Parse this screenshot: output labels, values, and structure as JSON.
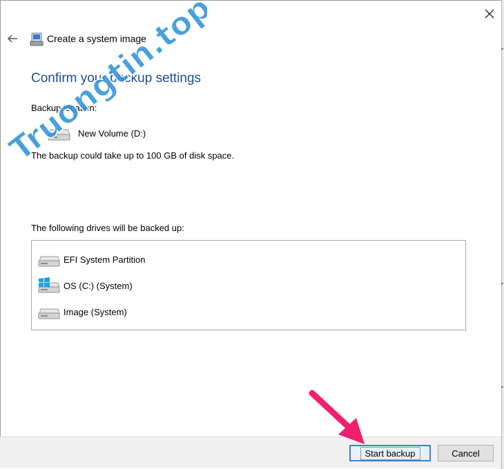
{
  "window": {
    "title": "Create a system image"
  },
  "page": {
    "heading": "Confirm your backup settings",
    "backup_location_label": "Backup location:",
    "backup_location_drive": "New Volume (D:)",
    "space_note": "The backup could take up to 100 GB of disk space.",
    "drives_label": "The following drives will be backed up:",
    "drives": [
      {
        "name": "EFI System Partition",
        "icon": "drive-icon"
      },
      {
        "name": "OS (C:) (System)",
        "icon": "windows-drive-icon"
      },
      {
        "name": "Image (System)",
        "icon": "drive-icon"
      }
    ]
  },
  "buttons": {
    "start_backup": "Start backup",
    "cancel": "Cancel"
  },
  "watermark_text": "Truongtin.top",
  "colors": {
    "heading": "#1f4e99",
    "primary_border": "#3c7fd8",
    "footer": "#f0f0f0",
    "arrow": "#f0206e",
    "watermark_blue": "#2a8fd6",
    "watermark_red": "#e8284a"
  }
}
